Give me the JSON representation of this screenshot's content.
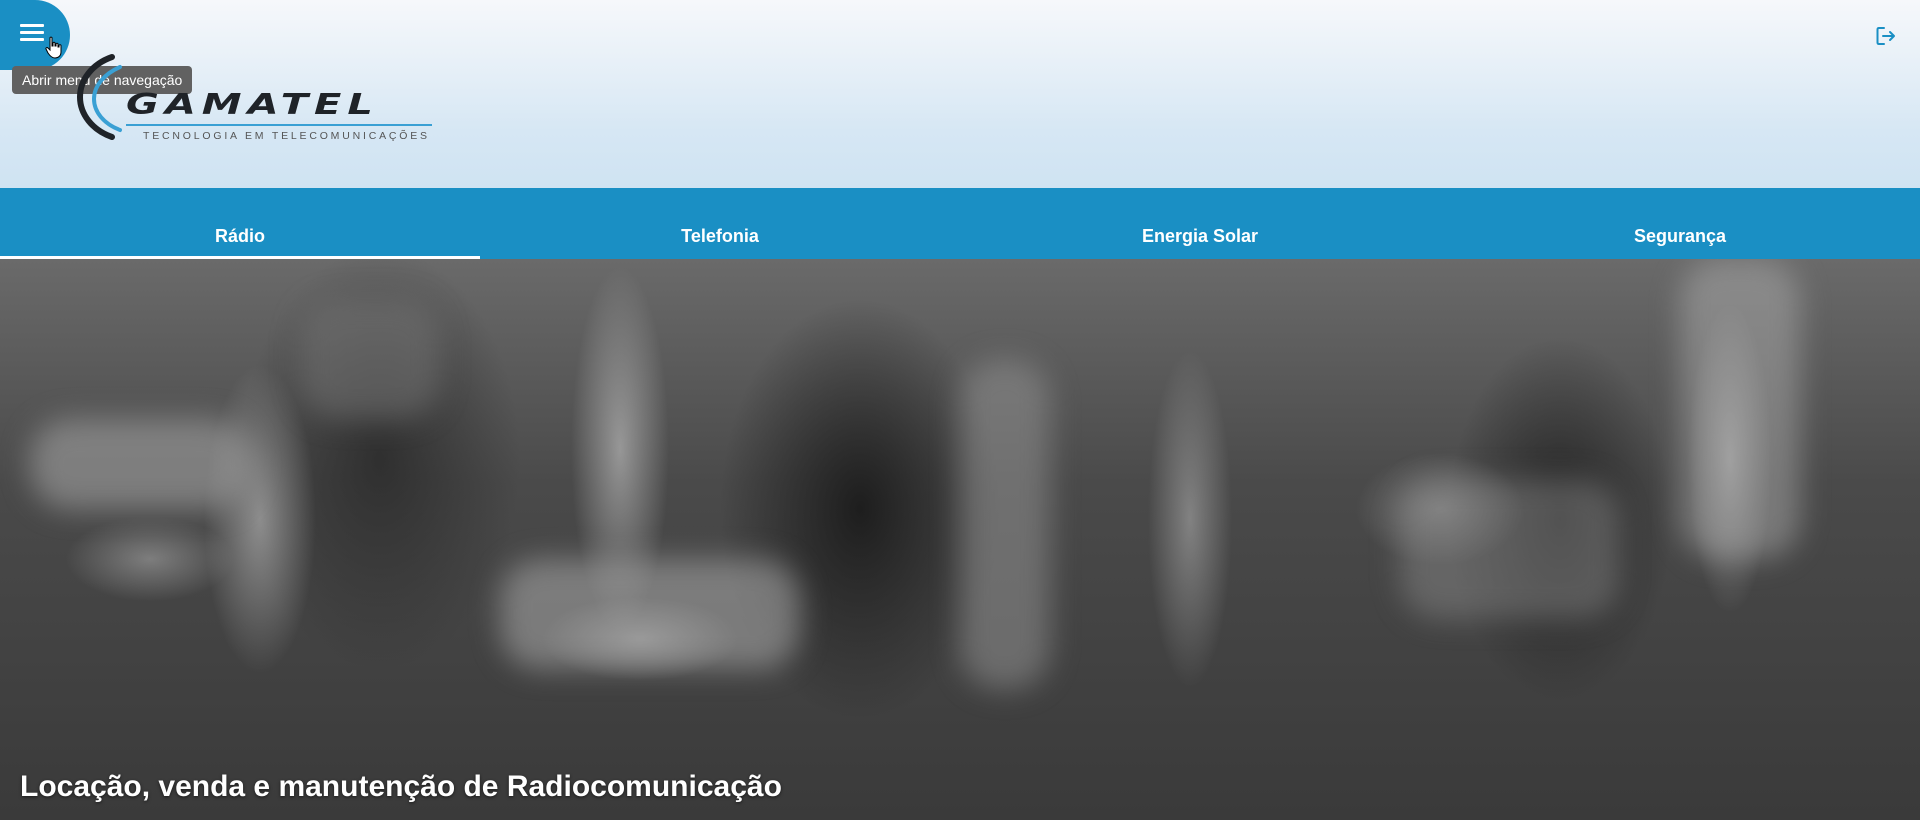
{
  "header": {
    "menu_tooltip": "Abrir menu de navegação",
    "logo": {
      "name": "GAMATEL",
      "tagline": "TECNOLOGIA EM TELECOMUNICAÇÕES"
    },
    "icons": {
      "menu": "menu-icon",
      "logout": "logout-icon"
    }
  },
  "tabs": [
    {
      "label": "Rádio",
      "active": true
    },
    {
      "label": "Telefonia",
      "active": false
    },
    {
      "label": "Energia Solar",
      "active": false
    },
    {
      "label": "Segurança",
      "active": false
    }
  ],
  "hero": {
    "caption": "Locação, venda e manutenção de Radiocomunicação"
  },
  "colors": {
    "primary": "#1a8fc4",
    "tooltip_bg": "#616161",
    "header_bg": "#d6e7f4"
  }
}
